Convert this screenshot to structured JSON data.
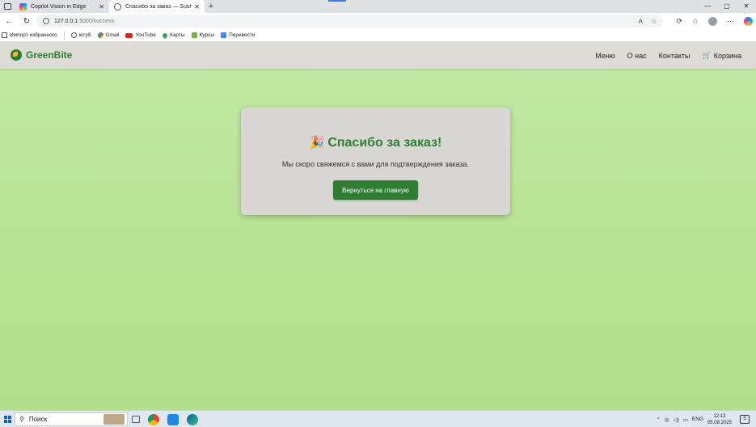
{
  "browser": {
    "tabs": [
      {
        "title": "Copilot Vision in Edge",
        "active": false
      },
      {
        "title": "Спасибо за заказ — SushiTime",
        "active": true
      }
    ],
    "new_tab": "+",
    "window_controls": [
      "—",
      "▢",
      "✕"
    ],
    "url_host": "127.0.0.1",
    "url_path": ":5000/success",
    "bookmarks": [
      {
        "label": "Импорт избранного",
        "icon": "folder-icon"
      },
      {
        "label": "ютуб",
        "icon": "globe-icon"
      },
      {
        "label": "Gmail",
        "icon": "google-icon"
      },
      {
        "label": "YouTube",
        "icon": "youtube-icon"
      },
      {
        "label": "Карты",
        "icon": "maps-icon"
      },
      {
        "label": "Курсы",
        "icon": "courses-icon"
      },
      {
        "label": "Перевести",
        "icon": "translate-icon"
      }
    ]
  },
  "site": {
    "brand": "GreenBite",
    "nav": {
      "menu": "Меню",
      "about": "О нас",
      "contacts": "Контакты",
      "cart": "Корзина"
    },
    "card": {
      "emoji": "🎉",
      "title": "Спасибо за заказ!",
      "message": "Мы скоро свяжемся с вами для подтверждения заказа.",
      "button": "Вернуться на главную"
    }
  },
  "taskbar": {
    "search_label": "Поиск",
    "lang": "ENG",
    "time": "12:13",
    "date": "05.08.2025",
    "notifications": "5"
  },
  "colors": {
    "brand_green": "#2e7d32",
    "page_bg": "#b7e293",
    "card_bg": "#d9d7d3"
  }
}
